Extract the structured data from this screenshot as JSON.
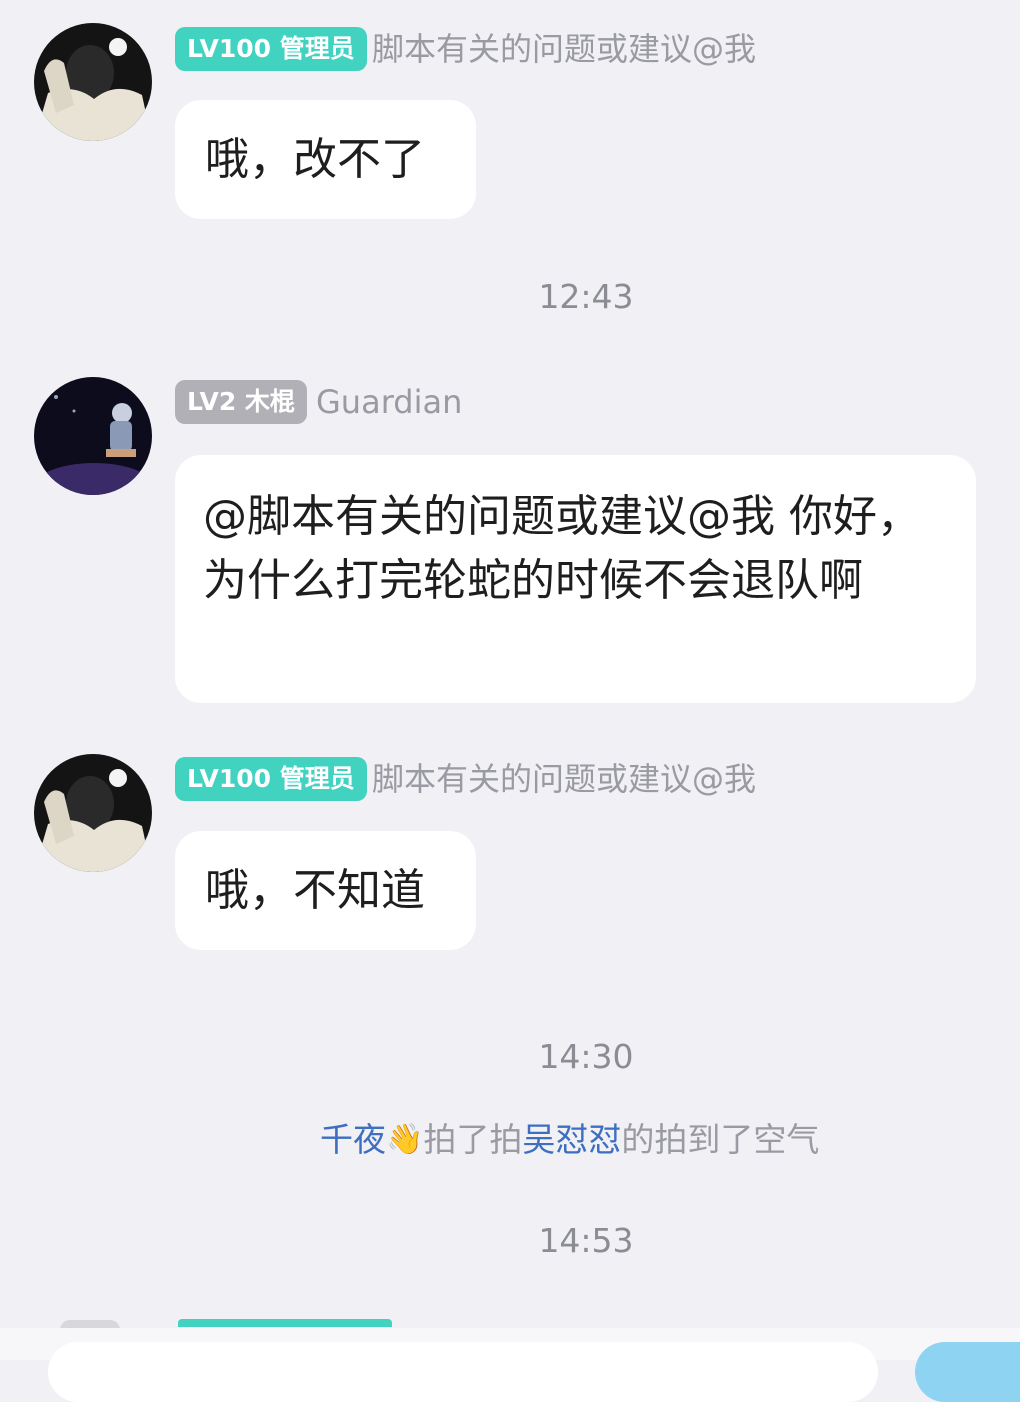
{
  "messages": [
    {
      "badge": "LV100 管理员",
      "nickname": "脚本有关的问题或建议@我",
      "text": "哦，改不了"
    },
    {
      "badge": "LV2 木棍",
      "nickname": "Guardian",
      "text": "@脚本有关的问题或建议@我 你好，为什么打完轮蛇的时候不会退队啊"
    },
    {
      "badge": "LV100 管理员",
      "nickname": "脚本有关的问题或建议@我",
      "text": "哦，不知道"
    }
  ],
  "timestamps": [
    "12:43",
    "14:30",
    "14:53"
  ],
  "nudge": {
    "actor": "千夜",
    "emoji": "👋",
    "verb": "拍了拍",
    "target": "吴怼怼",
    "suffix": "的拍到了空气"
  },
  "colors": {
    "admin_badge": "#41d2c0",
    "member_badge": "#b0b0b6",
    "nudge_name": "#3e6ec0",
    "background": "#f0f0f5"
  },
  "icons": {
    "admin_avatar": "avatar-photo",
    "member_avatar": "avatar-photo",
    "nudge": "waving-hand-icon"
  }
}
